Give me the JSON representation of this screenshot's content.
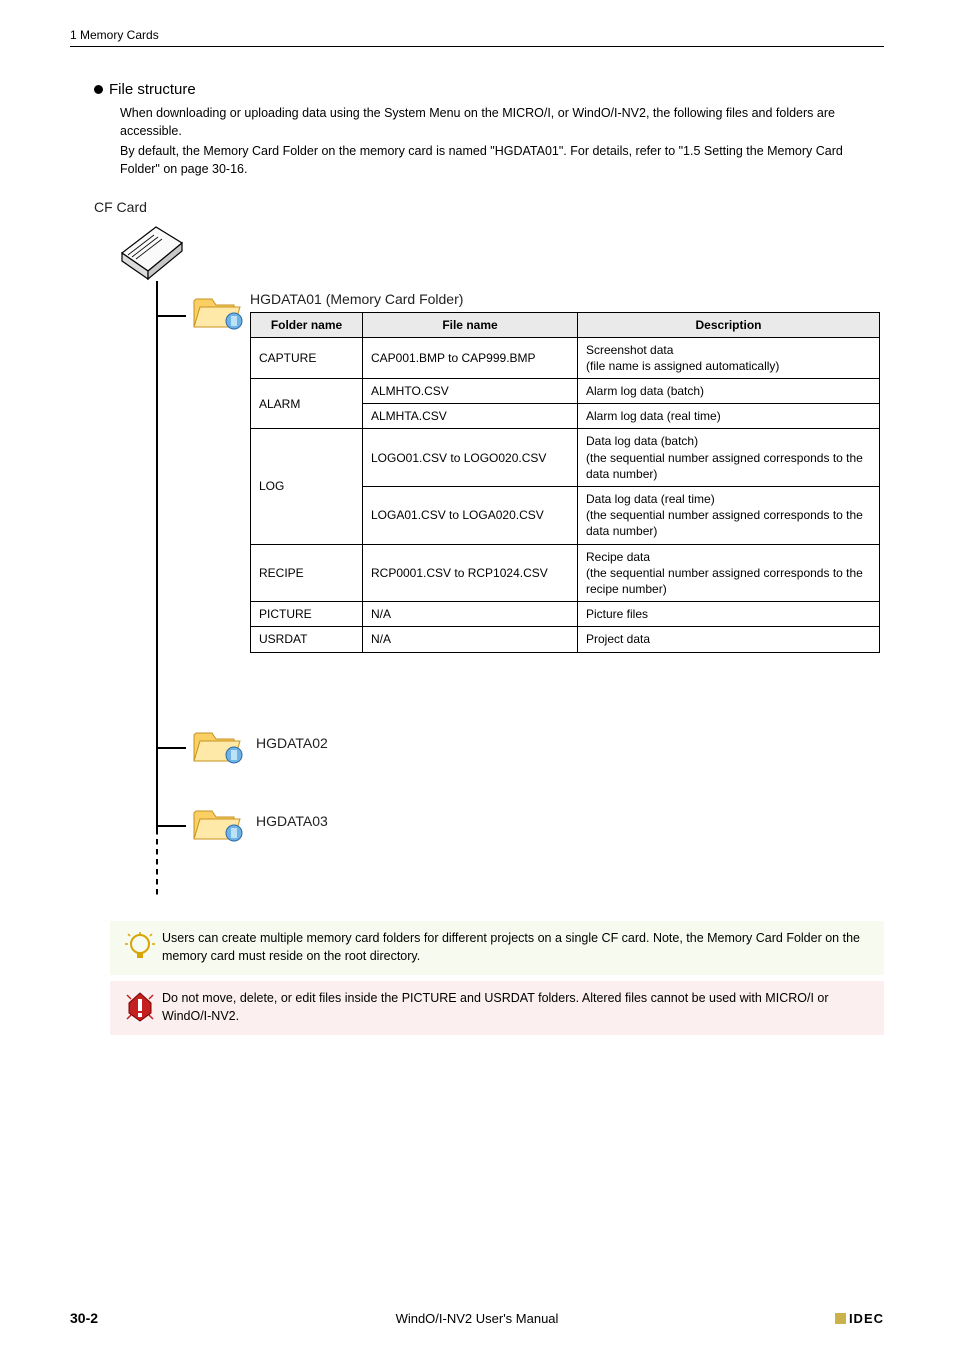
{
  "header": {
    "title": "1 Memory Cards"
  },
  "section": {
    "bullet_title": "File structure",
    "intro1": "When downloading or uploading data using the System Menu on the MICRO/I, or WindO/I-NV2, the following files and folders are accessible.",
    "intro2": "By default, the Memory Card Folder on the memory card is named \"HGDATA01\". For details, refer to \"1.5 Setting the Memory Card Folder\" on page 30-16."
  },
  "cf_label": "CF Card",
  "folder1_label": "HGDATA01 (Memory Card Folder)",
  "folder2_label": "HGDATA02",
  "folder3_label": "HGDATA03",
  "table": {
    "headers": {
      "c1": "Folder name",
      "c2": "File name",
      "c3": "Description"
    },
    "rows": [
      {
        "folder": "CAPTURE",
        "rowspan": 1,
        "file": "CAP001.BMP to CAP999.BMP",
        "desc": "Screenshot data\n(file name is assigned automatically)"
      },
      {
        "folder": "ALARM",
        "rowspan": 2,
        "file": "ALMHTO.CSV",
        "desc": "Alarm log data (batch)"
      },
      {
        "folder": "",
        "rowspan": 0,
        "file": "ALMHTA.CSV",
        "desc": "Alarm log data (real time)"
      },
      {
        "folder": "LOG",
        "rowspan": 2,
        "file": "LOGO01.CSV to LOGO020.CSV",
        "desc": "Data log data (batch)\n(the sequential number assigned corresponds to the data number)"
      },
      {
        "folder": "",
        "rowspan": 0,
        "file": "LOGA01.CSV to LOGA020.CSV",
        "desc": "Data log data (real time)\n(the sequential number assigned corresponds to the data number)"
      },
      {
        "folder": "RECIPE",
        "rowspan": 1,
        "file": "RCP0001.CSV to RCP1024.CSV",
        "desc": "Recipe data\n(the sequential number assigned corresponds to the recipe number)"
      },
      {
        "folder": "PICTURE",
        "rowspan": 1,
        "file": "N/A",
        "desc": "Picture files"
      },
      {
        "folder": "USRDAT",
        "rowspan": 1,
        "file": "N/A",
        "desc": "Project data"
      }
    ]
  },
  "notes": {
    "tip": "Users can create multiple memory card folders for different projects on a single CF card. Note, the Memory Card Folder on the memory card must reside on the root directory.",
    "warn": "Do not move, delete, or edit files inside the PICTURE and USRDAT folders. Altered files cannot be used with MICRO/I or WindO/I-NV2."
  },
  "footer": {
    "page": "30-2",
    "center": "WindO/I-NV2 User's Manual",
    "brand": "IDEC"
  }
}
